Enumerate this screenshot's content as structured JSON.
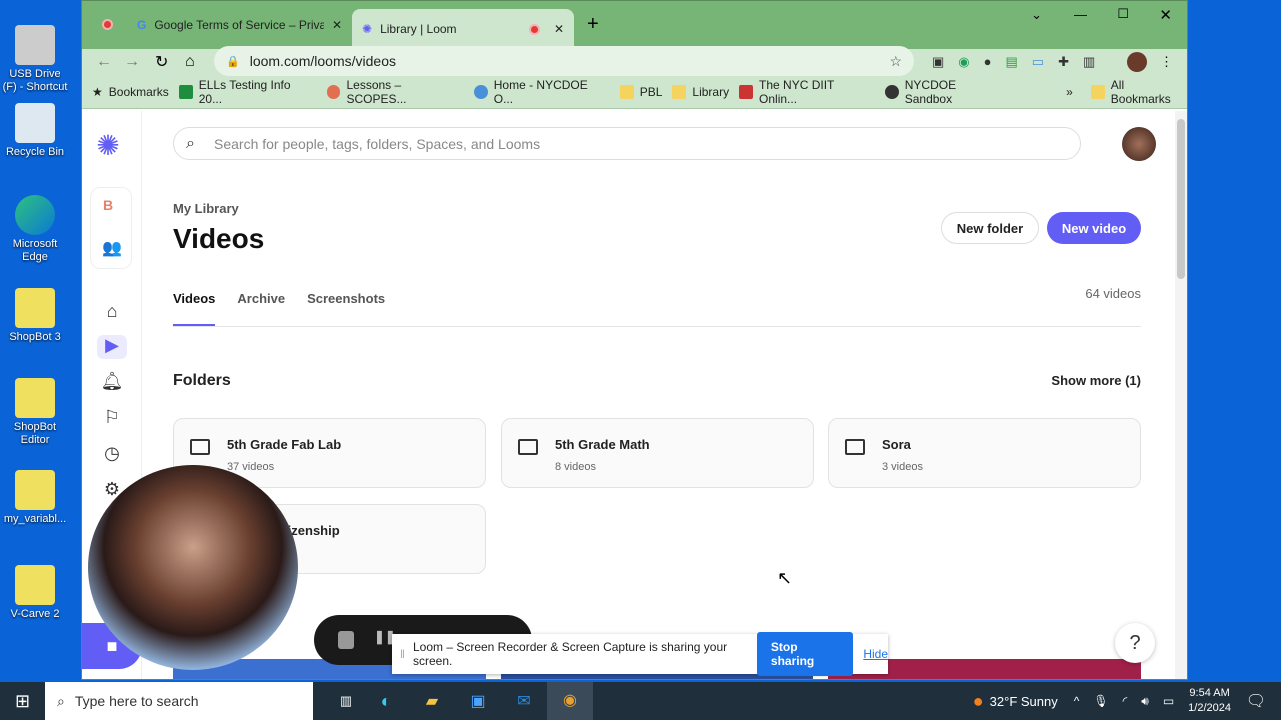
{
  "desktop": {
    "icons": [
      "USB Drive (F) - Shortcut",
      "Recycle Bin",
      "Microsoft Edge",
      "ShopBot 3",
      "ShopBot Editor",
      "my_variabl...",
      "V-Carve 2"
    ]
  },
  "browser": {
    "tabs": [
      {
        "title": "Google Terms of Service – Privac"
      },
      {
        "title": "Library | Loom"
      }
    ],
    "url": "loom.com/looms/videos",
    "bookmarks": [
      "Bookmarks",
      "ELLs Testing Info 20...",
      "Lessons – SCOPES...",
      "Home - NYCDOE O...",
      "PBL",
      "Library",
      "The NYC DIIT Onlin...",
      "NYCDOE Sandbox"
    ],
    "all_bookmarks": "All Bookmarks"
  },
  "loom": {
    "search_placeholder": "Search for people, tags, folders, Spaces, and Looms",
    "workspace_letter": "B",
    "breadcrumb": "My Library",
    "title": "Videos",
    "new_folder": "New folder",
    "new_video": "New video",
    "tabs": [
      "Videos",
      "Archive",
      "Screenshots"
    ],
    "video_count": "64 videos",
    "folders_heading": "Folders",
    "show_more": "Show more (1)",
    "folders": [
      {
        "name": "5th Grade Fab Lab",
        "count": "37 videos"
      },
      {
        "name": "5th Grade Math",
        "count": "8 videos"
      },
      {
        "name": "Sora",
        "count": "3 videos"
      },
      {
        "name": "Digital Citizenship",
        "count": ""
      }
    ],
    "help": "?",
    "accent": "#625df5"
  },
  "share_bar": {
    "message": "Loom – Screen Recorder & Screen Capture is sharing your screen.",
    "stop": "Stop sharing",
    "hide": "Hide"
  },
  "taskbar": {
    "search_placeholder": "Type here to search",
    "weather": "32°F  Sunny",
    "weather_badge": "1",
    "time": "9:54 AM",
    "date": "1/2/2024"
  }
}
